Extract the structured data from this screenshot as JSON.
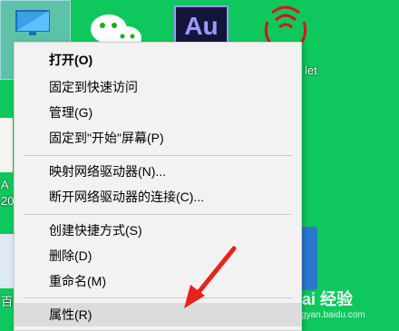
{
  "desktop": {
    "icons": [
      {
        "name": "this-pc",
        "label": ""
      },
      {
        "name": "wechat",
        "label": ""
      },
      {
        "name": "adobe-audition",
        "label": "Au"
      },
      {
        "name": "radio-app",
        "label": "let"
      }
    ],
    "partial_labels": {
      "left_a": "A",
      "left_20": "20",
      "left_bai": "百"
    },
    "watermark_text": "Bai 经验",
    "watermark_url": "jingyan.baidu.com"
  },
  "context_menu": {
    "groups": [
      [
        {
          "label": "打开(O)",
          "bold": true
        },
        {
          "label": "固定到快速访问"
        },
        {
          "label": "管理(G)"
        },
        {
          "label": "固定到\"开始\"屏幕(P)"
        }
      ],
      [
        {
          "label": "映射网络驱动器(N)..."
        },
        {
          "label": "断开网络驱动器的连接(C)..."
        }
      ],
      [
        {
          "label": "创建快捷方式(S)"
        },
        {
          "label": "删除(D)"
        },
        {
          "label": "重命名(M)"
        }
      ],
      [
        {
          "label": "属性(R)",
          "hover": true
        }
      ]
    ]
  },
  "colors": {
    "desktop_bg": "#0fc85d",
    "menu_bg": "#f2f2f2",
    "arrow": "#e8231f"
  }
}
